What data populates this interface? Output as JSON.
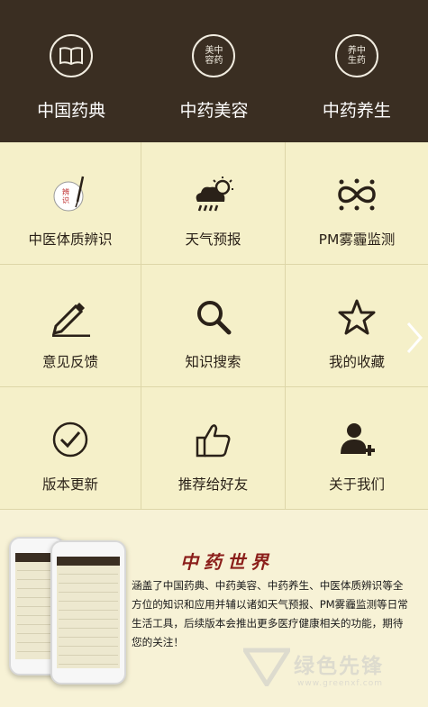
{
  "top_nav": [
    {
      "label": "中国药典",
      "icon": "book-icon"
    },
    {
      "label": "中药美容",
      "icon": "beauty-seal-icon",
      "seal": [
        "美",
        "容",
        "中",
        "药"
      ]
    },
    {
      "label": "中药养生",
      "icon": "health-seal-icon",
      "seal": [
        "养",
        "生",
        "中",
        "药"
      ]
    }
  ],
  "grid": [
    {
      "label": "中医体质辨识",
      "icon": "brush-ink-icon",
      "seal": [
        "辨",
        "识"
      ]
    },
    {
      "label": "天气预报",
      "icon": "weather-icon"
    },
    {
      "label": "PM雾霾监测",
      "icon": "infinity-icon"
    },
    {
      "label": "意见反馈",
      "icon": "pencil-icon"
    },
    {
      "label": "知识搜索",
      "icon": "search-icon"
    },
    {
      "label": "我的收藏",
      "icon": "star-icon"
    },
    {
      "label": "版本更新",
      "icon": "check-circle-icon"
    },
    {
      "label": "推荐给好友",
      "icon": "thumbs-up-icon"
    },
    {
      "label": "关于我们",
      "icon": "user-add-icon"
    }
  ],
  "promo": {
    "title": "中药世界",
    "description": "涵盖了中国药典、中药美容、中药养生、中医体质辨识等全方位的知识和应用并辅以诸如天气预报、PM雾霾监测等日常生活工具，后续版本会推出更多医疗健康相关的功能，期待您的关注！"
  },
  "watermark": {
    "text": "绿色先锋",
    "url": "www.greenxf.com"
  },
  "colors": {
    "header_bg": "#3a2e22",
    "grid_bg": "#f5f0c9",
    "title_red": "#8b1e1a"
  }
}
